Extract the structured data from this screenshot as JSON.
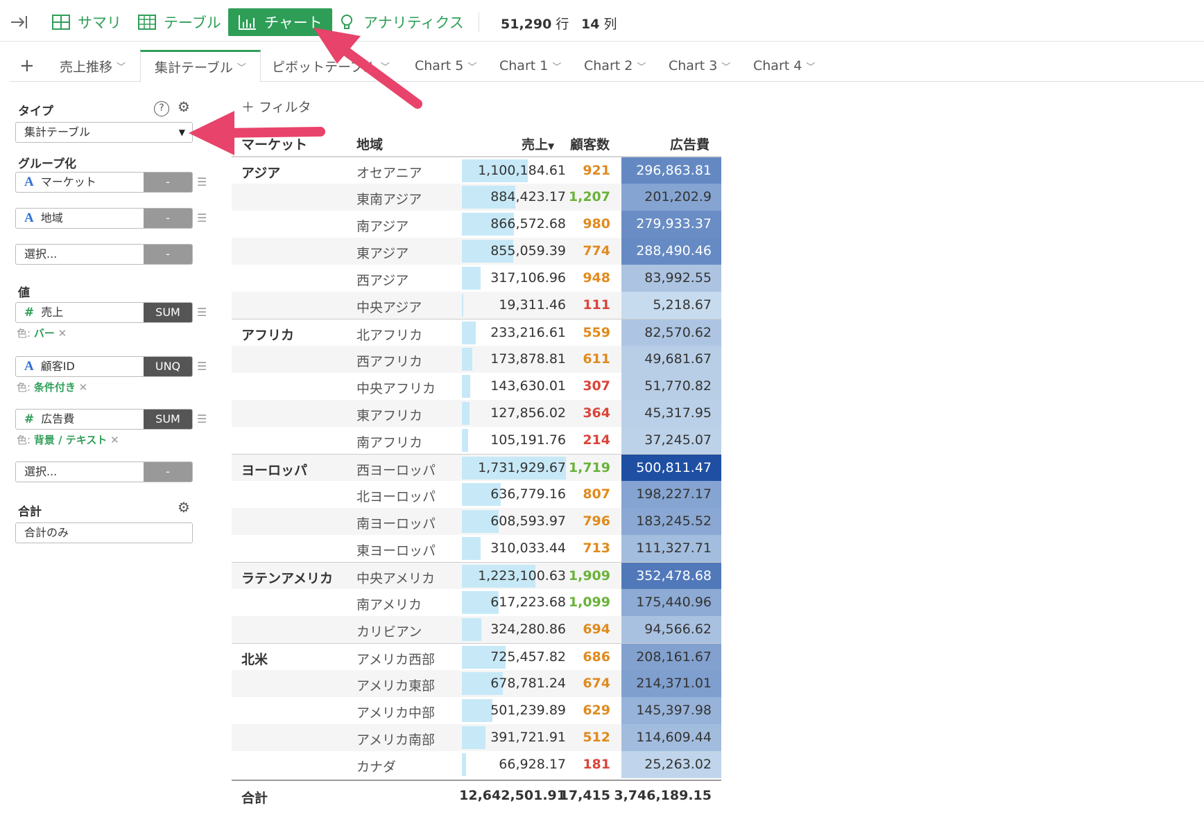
{
  "toolbar": {
    "summary": "サマリ",
    "table": "テーブル",
    "chart": "チャート",
    "analytics": "アナリティクス",
    "rows_count": "51,290",
    "rows_unit": "行",
    "cols_count": "14",
    "cols_unit": "列"
  },
  "tabs": [
    {
      "label": "売上推移",
      "active": false
    },
    {
      "label": "集計テーブル",
      "active": true
    },
    {
      "label": "ピボットテーブル",
      "active": false
    },
    {
      "label": "Chart 5",
      "active": false
    },
    {
      "label": "Chart 1",
      "active": false
    },
    {
      "label": "Chart 2",
      "active": false
    },
    {
      "label": "Chart 3",
      "active": false
    },
    {
      "label": "Chart 4",
      "active": false
    }
  ],
  "panel": {
    "type_title": "タイプ",
    "type_value": "集計テーブル",
    "group_title": "グループ化",
    "group_fields": [
      {
        "name": "マーケット",
        "type": "A",
        "agg": "-"
      },
      {
        "name": "地域",
        "type": "A",
        "agg": "-"
      },
      {
        "name": "選択...",
        "type": "",
        "agg": "-"
      }
    ],
    "value_title": "値",
    "value_fields": [
      {
        "name": "売上",
        "type": "#",
        "agg": "SUM",
        "color_label": "色:",
        "color_value": "バー"
      },
      {
        "name": "顧客ID",
        "type": "A",
        "agg": "UNQ",
        "color_label": "色:",
        "color_value": "条件付き"
      },
      {
        "name": "広告費",
        "type": "#",
        "agg": "SUM",
        "color_label": "色:",
        "color_value": "背景 / テキスト"
      }
    ],
    "value_select": "選択...",
    "value_select_agg": "-",
    "total_title": "合計",
    "total_value": "合計のみ"
  },
  "filter_label": "フィルタ",
  "table": {
    "headers": {
      "market": "マーケット",
      "region": "地域",
      "sales": "売上",
      "customers": "顧客数",
      "ad": "広告費"
    },
    "rows": [
      {
        "market": "アジア",
        "region": "オセアニア",
        "sales": "1,100,184.61",
        "sales_frac": 0.635,
        "customers": "921",
        "cust_color": "#e08a1e",
        "ad": "296,863.81",
        "ad_frac": 0.59
      },
      {
        "market": "",
        "region": "東南アジア",
        "sales": "884,423.17",
        "sales_frac": 0.51,
        "customers": "1,207",
        "cust_color": "#6ab23a",
        "ad": "201,202.9",
        "ad_frac": 0.4
      },
      {
        "market": "",
        "region": "南アジア",
        "sales": "866,572.68",
        "sales_frac": 0.5,
        "customers": "980",
        "cust_color": "#e08a1e",
        "ad": "279,933.37",
        "ad_frac": 0.56
      },
      {
        "market": "",
        "region": "東アジア",
        "sales": "855,059.39",
        "sales_frac": 0.49,
        "customers": "774",
        "cust_color": "#e08a1e",
        "ad": "288,490.46",
        "ad_frac": 0.58
      },
      {
        "market": "",
        "region": "西アジア",
        "sales": "317,106.96",
        "sales_frac": 0.18,
        "customers": "948",
        "cust_color": "#e08a1e",
        "ad": "83,992.55",
        "ad_frac": 0.17
      },
      {
        "market": "",
        "region": "中央アジア",
        "sales": "19,311.46",
        "sales_frac": 0.011,
        "customers": "111",
        "cust_color": "#d9453a",
        "ad": "5,218.67",
        "ad_frac": 0.01
      },
      {
        "market": "アフリカ",
        "region": "北アフリカ",
        "sales": "233,216.61",
        "sales_frac": 0.135,
        "customers": "559",
        "cust_color": "#e08a1e",
        "ad": "82,570.62",
        "ad_frac": 0.165
      },
      {
        "market": "",
        "region": "西アフリカ",
        "sales": "173,878.81",
        "sales_frac": 0.1,
        "customers": "611",
        "cust_color": "#e08a1e",
        "ad": "49,681.67",
        "ad_frac": 0.1
      },
      {
        "market": "",
        "region": "中央アフリカ",
        "sales": "143,630.01",
        "sales_frac": 0.083,
        "customers": "307",
        "cust_color": "#d9453a",
        "ad": "51,770.82",
        "ad_frac": 0.1
      },
      {
        "market": "",
        "region": "東アフリカ",
        "sales": "127,856.02",
        "sales_frac": 0.074,
        "customers": "364",
        "cust_color": "#d9453a",
        "ad": "45,317.95",
        "ad_frac": 0.09
      },
      {
        "market": "",
        "region": "南アフリカ",
        "sales": "105,191.76",
        "sales_frac": 0.061,
        "customers": "214",
        "cust_color": "#d9453a",
        "ad": "37,245.07",
        "ad_frac": 0.074
      },
      {
        "market": "ヨーロッパ",
        "region": "西ヨーロッパ",
        "sales": "1,731,929.67",
        "sales_frac": 1.0,
        "customers": "1,719",
        "cust_color": "#6ab23a",
        "ad": "500,811.47",
        "ad_frac": 1.0
      },
      {
        "market": "",
        "region": "北ヨーロッパ",
        "sales": "636,779.16",
        "sales_frac": 0.37,
        "customers": "807",
        "cust_color": "#e08a1e",
        "ad": "198,227.17",
        "ad_frac": 0.4
      },
      {
        "market": "",
        "region": "南ヨーロッパ",
        "sales": "608,593.97",
        "sales_frac": 0.35,
        "customers": "796",
        "cust_color": "#e08a1e",
        "ad": "183,245.52",
        "ad_frac": 0.37
      },
      {
        "market": "",
        "region": "東ヨーロッパ",
        "sales": "310,033.44",
        "sales_frac": 0.18,
        "customers": "713",
        "cust_color": "#e08a1e",
        "ad": "111,327.71",
        "ad_frac": 0.22
      },
      {
        "market": "ラテンアメリカ",
        "region": "中央アメリカ",
        "sales": "1,223,100.63",
        "sales_frac": 0.705,
        "customers": "1,909",
        "cust_color": "#6ab23a",
        "ad": "352,478.68",
        "ad_frac": 0.7
      },
      {
        "market": "",
        "region": "南アメリカ",
        "sales": "617,223.68",
        "sales_frac": 0.356,
        "customers": "1,099",
        "cust_color": "#6ab23a",
        "ad": "175,440.96",
        "ad_frac": 0.35
      },
      {
        "market": "",
        "region": "カリビアン",
        "sales": "324,280.86",
        "sales_frac": 0.187,
        "customers": "694",
        "cust_color": "#e08a1e",
        "ad": "94,566.62",
        "ad_frac": 0.19
      },
      {
        "market": "北米",
        "region": "アメリカ西部",
        "sales": "725,457.82",
        "sales_frac": 0.42,
        "customers": "686",
        "cust_color": "#e08a1e",
        "ad": "208,161.67",
        "ad_frac": 0.415
      },
      {
        "market": "",
        "region": "アメリカ東部",
        "sales": "678,781.24",
        "sales_frac": 0.39,
        "customers": "674",
        "cust_color": "#e08a1e",
        "ad": "214,371.01",
        "ad_frac": 0.43
      },
      {
        "market": "",
        "region": "アメリカ中部",
        "sales": "501,239.89",
        "sales_frac": 0.29,
        "customers": "629",
        "cust_color": "#e08a1e",
        "ad": "145,397.98",
        "ad_frac": 0.29
      },
      {
        "market": "",
        "region": "アメリカ南部",
        "sales": "391,721.91",
        "sales_frac": 0.226,
        "customers": "512",
        "cust_color": "#e08a1e",
        "ad": "114,609.44",
        "ad_frac": 0.23
      },
      {
        "market": "",
        "region": "カナダ",
        "sales": "66,928.17",
        "sales_frac": 0.039,
        "customers": "181",
        "cust_color": "#d9453a",
        "ad": "25,263.02",
        "ad_frac": 0.05
      }
    ],
    "total": {
      "label": "合計",
      "sales": "12,642,501.91",
      "customers": "17,415",
      "ad": "3,746,189.15"
    }
  },
  "colors": {
    "accent": "#2e9e57",
    "arrow": "#e8436a",
    "bar": "#c7e9f7"
  }
}
